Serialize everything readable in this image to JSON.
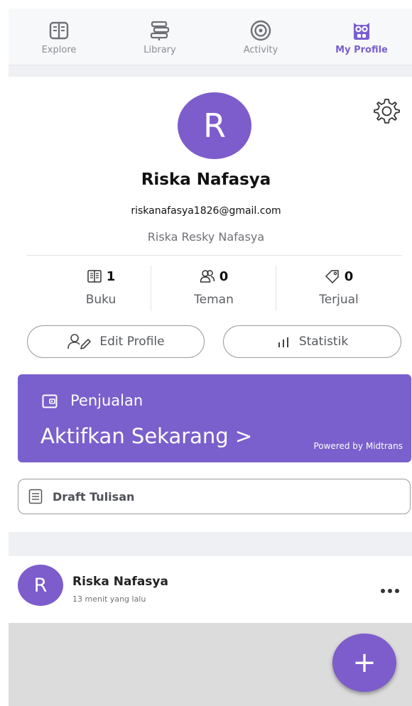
{
  "nav": {
    "items": [
      {
        "label": "Explore",
        "icon": "book-open-icon",
        "active": false
      },
      {
        "label": "Library",
        "icon": "library-stack-icon",
        "active": false
      },
      {
        "label": "Activity",
        "icon": "target-icon",
        "active": false
      },
      {
        "label": "My Profile",
        "icon": "owl-icon",
        "active": true
      }
    ]
  },
  "profile": {
    "avatar_letter": "R",
    "name": "Riska Nafasya",
    "email": "riskanafasya1826@gmail.com",
    "full_name": "Riska Resky Nafasya"
  },
  "stats": [
    {
      "value": "1",
      "label": "Buku",
      "icon": "book-icon"
    },
    {
      "value": "0",
      "label": "Teman",
      "icon": "friends-icon"
    },
    {
      "value": "0",
      "label": "Terjual",
      "icon": "tag-icon"
    }
  ],
  "buttons": {
    "edit_profile": "Edit Profile",
    "statistik": "Statistik"
  },
  "sales": {
    "label": "Penjualan",
    "cta": "Aktifkan Sekarang >",
    "powered": "Powered by Midtrans"
  },
  "draft": {
    "label": "Draft Tulisan"
  },
  "post": {
    "avatar_letter": "R",
    "author": "Riska Nafasya",
    "time": "13 menit yang lalu"
  },
  "fab": {
    "label": "+"
  },
  "colors": {
    "accent": "#7960cc",
    "avatar": "#7d5ccc",
    "nav_active": "#7a5fd0"
  }
}
